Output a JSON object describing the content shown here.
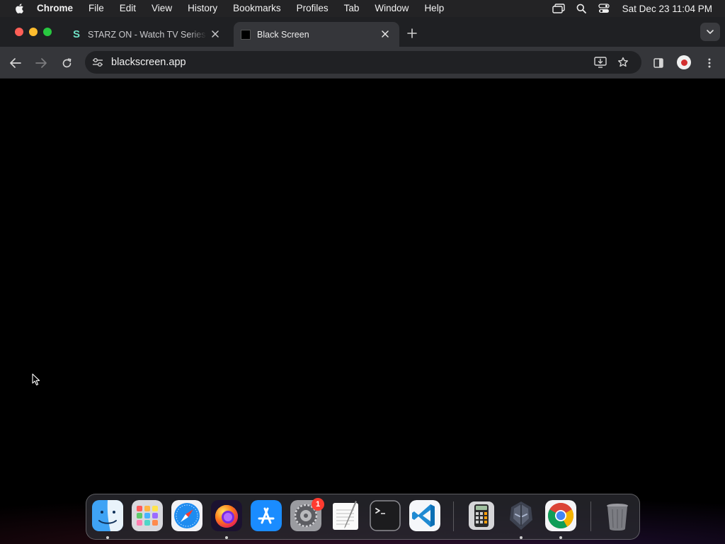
{
  "menubar": {
    "app_name": "Chrome",
    "items": [
      "File",
      "Edit",
      "View",
      "History",
      "Bookmarks",
      "Profiles",
      "Tab",
      "Window",
      "Help"
    ],
    "clock": "Sat Dec 23  11:04 PM"
  },
  "tabs": [
    {
      "title": "STARZ ON - Watch TV Series",
      "favicon_letter": "S",
      "active": false
    },
    {
      "title": "Black Screen",
      "active": true
    }
  ],
  "omnibox": {
    "url": "blackscreen.app"
  },
  "dock": {
    "apps": [
      "finder",
      "launchpad",
      "safari",
      "firefox",
      "app-store",
      "system-settings",
      "textedit",
      "terminal",
      "vscode",
      "calculator",
      "game-app",
      "chrome",
      "trash"
    ],
    "settings_badge": "1"
  },
  "colors": {
    "accent_red": "#ff5f57",
    "accent_yellow": "#febc2e",
    "accent_green": "#28c840",
    "toolbar": "#35363a",
    "tabstrip": "#1f2023"
  }
}
